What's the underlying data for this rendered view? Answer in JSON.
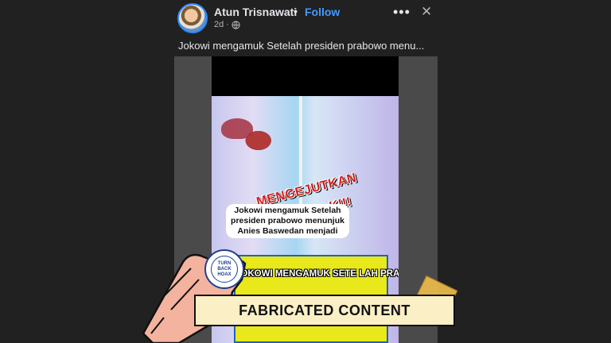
{
  "post": {
    "author": "Atun Trisnawati",
    "separator": "•",
    "follow_label": "Follow",
    "time": "2d",
    "caption": "Jokowi mengamuk  Setelah presiden prabowo menu..."
  },
  "icons": {
    "more": "more-icon",
    "close": "close-icon",
    "globe": "globe-icon"
  },
  "video": {
    "overlay_line1": "MENGEJUTKAN",
    "overlay_line2": "K!!!",
    "speech_text": "Jokowi mengamuk Setelah presiden prabowo menunjuk Anies Baswedan menjadi",
    "yellow_title": "JOKOWI MENGAMUK SETE LAH PRABOWO SUBIAN"
  },
  "badge": {
    "text": "TURN BACK HOAX"
  },
  "label": {
    "text": "FABRICATED CONTENT"
  },
  "colors": {
    "background": "#212121",
    "follow": "#4599ff",
    "banner": "#fbefc6",
    "tape": "#e8b84a"
  }
}
